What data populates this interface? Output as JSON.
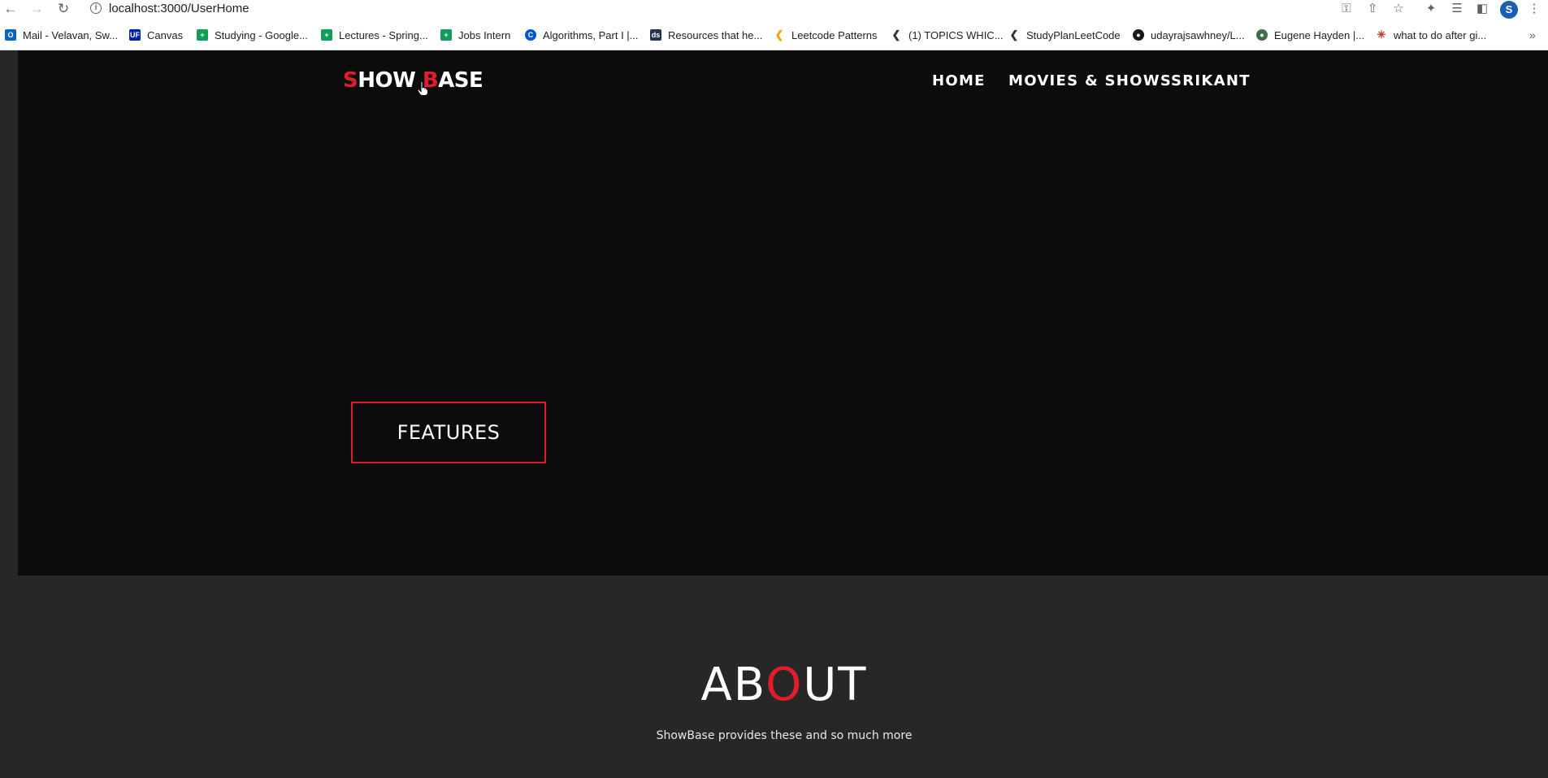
{
  "browser": {
    "url": "localhost:3000/UserHome",
    "profile_initial": "S",
    "bookmarks": [
      {
        "label": "Mail - Velavan, Sw...",
        "icon": "outlook-icon",
        "color": "#0a64c8"
      },
      {
        "label": "Canvas",
        "icon": "uf-icon",
        "color": "#0021a5"
      },
      {
        "label": "Studying - Google...",
        "icon": "sheets-icon",
        "color": "#0f9d58"
      },
      {
        "label": "Lectures - Spring...",
        "icon": "sheets-icon",
        "color": "#0f9d58"
      },
      {
        "label": "Jobs Intern",
        "icon": "sheets-icon",
        "color": "#0f9d58"
      },
      {
        "label": "Algorithms, Part I |...",
        "icon": "coursera-icon",
        "color": "#0056d2"
      },
      {
        "label": "Resources that he...",
        "icon": "site-icon",
        "color": "#24344d"
      },
      {
        "label": "Leetcode Patterns",
        "icon": "leetcode-icon",
        "color": "#f0a500"
      },
      {
        "label": "(1) TOPICS WHIC...",
        "icon": "leetcode-icon",
        "color": "#333333"
      },
      {
        "label": "StudyPlanLeetCode",
        "icon": "leetcode-icon",
        "color": "#333333"
      },
      {
        "label": "udayrajsawhney/L...",
        "icon": "github-icon",
        "color": "#181717"
      },
      {
        "label": "Eugene Hayden |...",
        "icon": "profile-icon",
        "color": "#3c6e47"
      },
      {
        "label": "what to do after gi...",
        "icon": "sparkle-icon",
        "color": "#999999"
      }
    ]
  },
  "site": {
    "logo_part1": "S",
    "logo_part2": "HOW ",
    "logo_part3": "B",
    "logo_part4": "ASE",
    "nav": {
      "home": "HOME",
      "movies": "MOVIES & SHOWS",
      "user": "SRIKANT"
    },
    "features_button": "FEATURES",
    "about": {
      "title_part1": "AB",
      "title_part2": "O",
      "title_part3": "UT",
      "subtitle": "ShowBase provides these and so much more"
    }
  }
}
